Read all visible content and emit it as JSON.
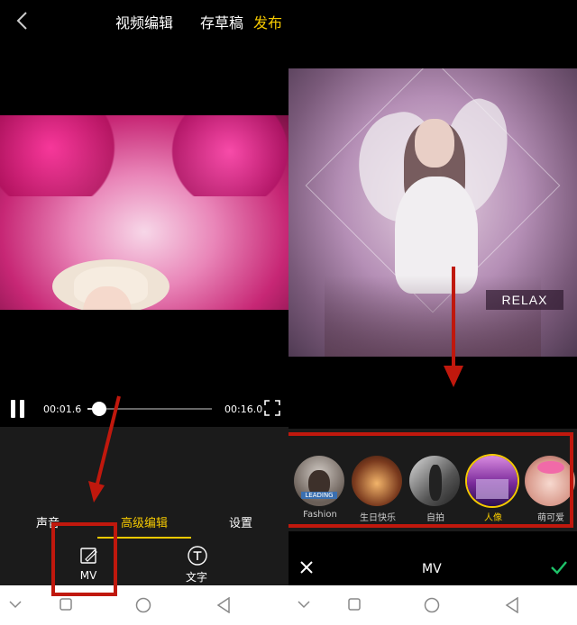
{
  "colors": {
    "accent": "#f5c900",
    "annotation": "#c0180d",
    "panel": "#1b1b1b",
    "check": "#1ec36a"
  },
  "left": {
    "header": {
      "title": "视频编辑",
      "draft": "存草稿",
      "publish": "发布"
    },
    "player": {
      "current_time": "00:01.6",
      "total_time": "00:16.0",
      "progress": 0.1
    },
    "tabs": [
      {
        "label": "声音"
      },
      {
        "label": "高级编辑",
        "selected": true
      },
      {
        "label": "设置"
      }
    ],
    "tools": [
      {
        "label": "MV",
        "icon": "mv-icon"
      },
      {
        "label": "文字",
        "icon": "text-t-icon"
      }
    ]
  },
  "right": {
    "overlay_text": "RELAX",
    "templates": [
      {
        "label": "Fashion",
        "badge": "LEADING"
      },
      {
        "label": "生日快乐"
      },
      {
        "label": "自拍"
      },
      {
        "label": "人像",
        "selected": true
      },
      {
        "label": "萌可爱"
      }
    ],
    "bottom": {
      "title": "MV"
    }
  }
}
